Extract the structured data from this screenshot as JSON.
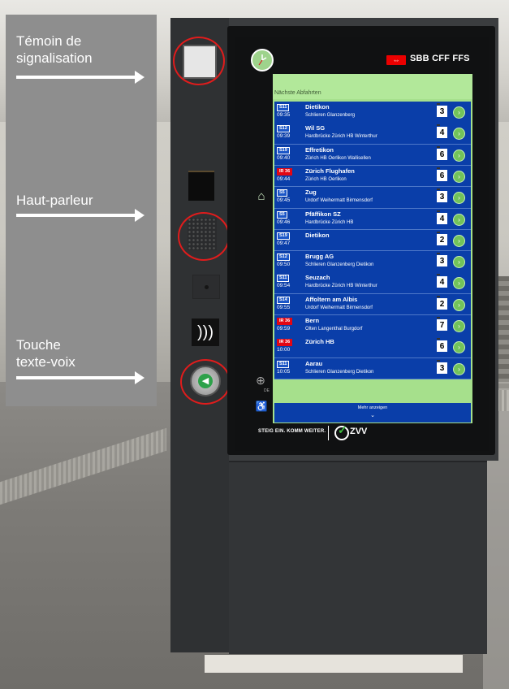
{
  "labels": {
    "signal": "Témoin de\nsignalisation",
    "speaker": "Haut-parleur",
    "tts": "Touche\ntexte-voix"
  },
  "screen": {
    "brand": "SBB CFF FFS",
    "header": "Nächste Abfahrten",
    "more": "Mehr anzeigen",
    "slogan": "STEIG EIN. KOMM WEITER.",
    "zvv": "ZVV"
  },
  "departures": [
    {
      "line": "S11",
      "dest": "Dietikon",
      "time": "09:35",
      "via": "Schlieren  Glanzenberg",
      "platform": "3",
      "ir": false
    },
    {
      "line": "S12",
      "dest": "Wil SG",
      "time": "09:39",
      "via": "Hardbrücke  Zürich HB  Winterthur",
      "platform": "4",
      "ir": false
    },
    {
      "line": "S19",
      "dest": "Effretikon",
      "time": "09:40",
      "via": "Zürich HB  Oerlikon  Wallisellen",
      "platform": "6",
      "ir": false
    },
    {
      "line": "IR 36",
      "dest": "Zürich Flughafen",
      "time": "09:44",
      "via": "Zürich HB  Oerlikon",
      "platform": "6",
      "ir": true
    },
    {
      "line": "S5",
      "dest": "Zug",
      "time": "09:45",
      "via": "Urdorf  Weihermatt  Birmensdorf",
      "platform": "3",
      "ir": false
    },
    {
      "line": "S5",
      "dest": "Pfäffikon SZ",
      "time": "09:46",
      "via": "Hardbrücke  Zürich HB",
      "platform": "4",
      "ir": false
    },
    {
      "line": "S19",
      "dest": "Dietikon",
      "time": "09:47",
      "via": "",
      "platform": "2",
      "ir": false
    },
    {
      "line": "S12",
      "dest": "Brugg AG",
      "time": "09:50",
      "via": "Schlieren  Glanzenberg  Dietikon",
      "platform": "3",
      "ir": false
    },
    {
      "line": "S11",
      "dest": "Seuzach",
      "time": "09:54",
      "via": "Hardbrücke  Zürich HB  Winterthur",
      "platform": "4",
      "ir": false
    },
    {
      "line": "S14",
      "dest": "Affoltern am Albis",
      "time": "09:55",
      "via": "Urdorf  Weihermatt  Birmensdorf",
      "platform": "2",
      "ir": false
    },
    {
      "line": "IR 36",
      "dest": "Bern",
      "time": "09:59",
      "via": "Olten  Langenthal  Burgdorf",
      "platform": "7",
      "ir": true
    },
    {
      "line": "IR 36",
      "dest": "Zürich HB",
      "time": "10:00",
      "via": "",
      "platform": "6",
      "ir": true
    },
    {
      "line": "S11",
      "dest": "Aarau",
      "time": "10:05",
      "via": "Schlieren  Glanzenberg  Dietikon",
      "platform": "3",
      "ir": false
    }
  ],
  "colors": {
    "highlight_ring": "#e01c1c",
    "screen_green": "#a6e08c",
    "row_blue": "#0a3ea9",
    "sbb_red": "#eb0000"
  },
  "icons": {
    "home": "home-icon",
    "globe": "globe-icon",
    "accessibility": "accessibility-icon",
    "nfc": "contactless-icon",
    "tts": "speaker-icon"
  }
}
